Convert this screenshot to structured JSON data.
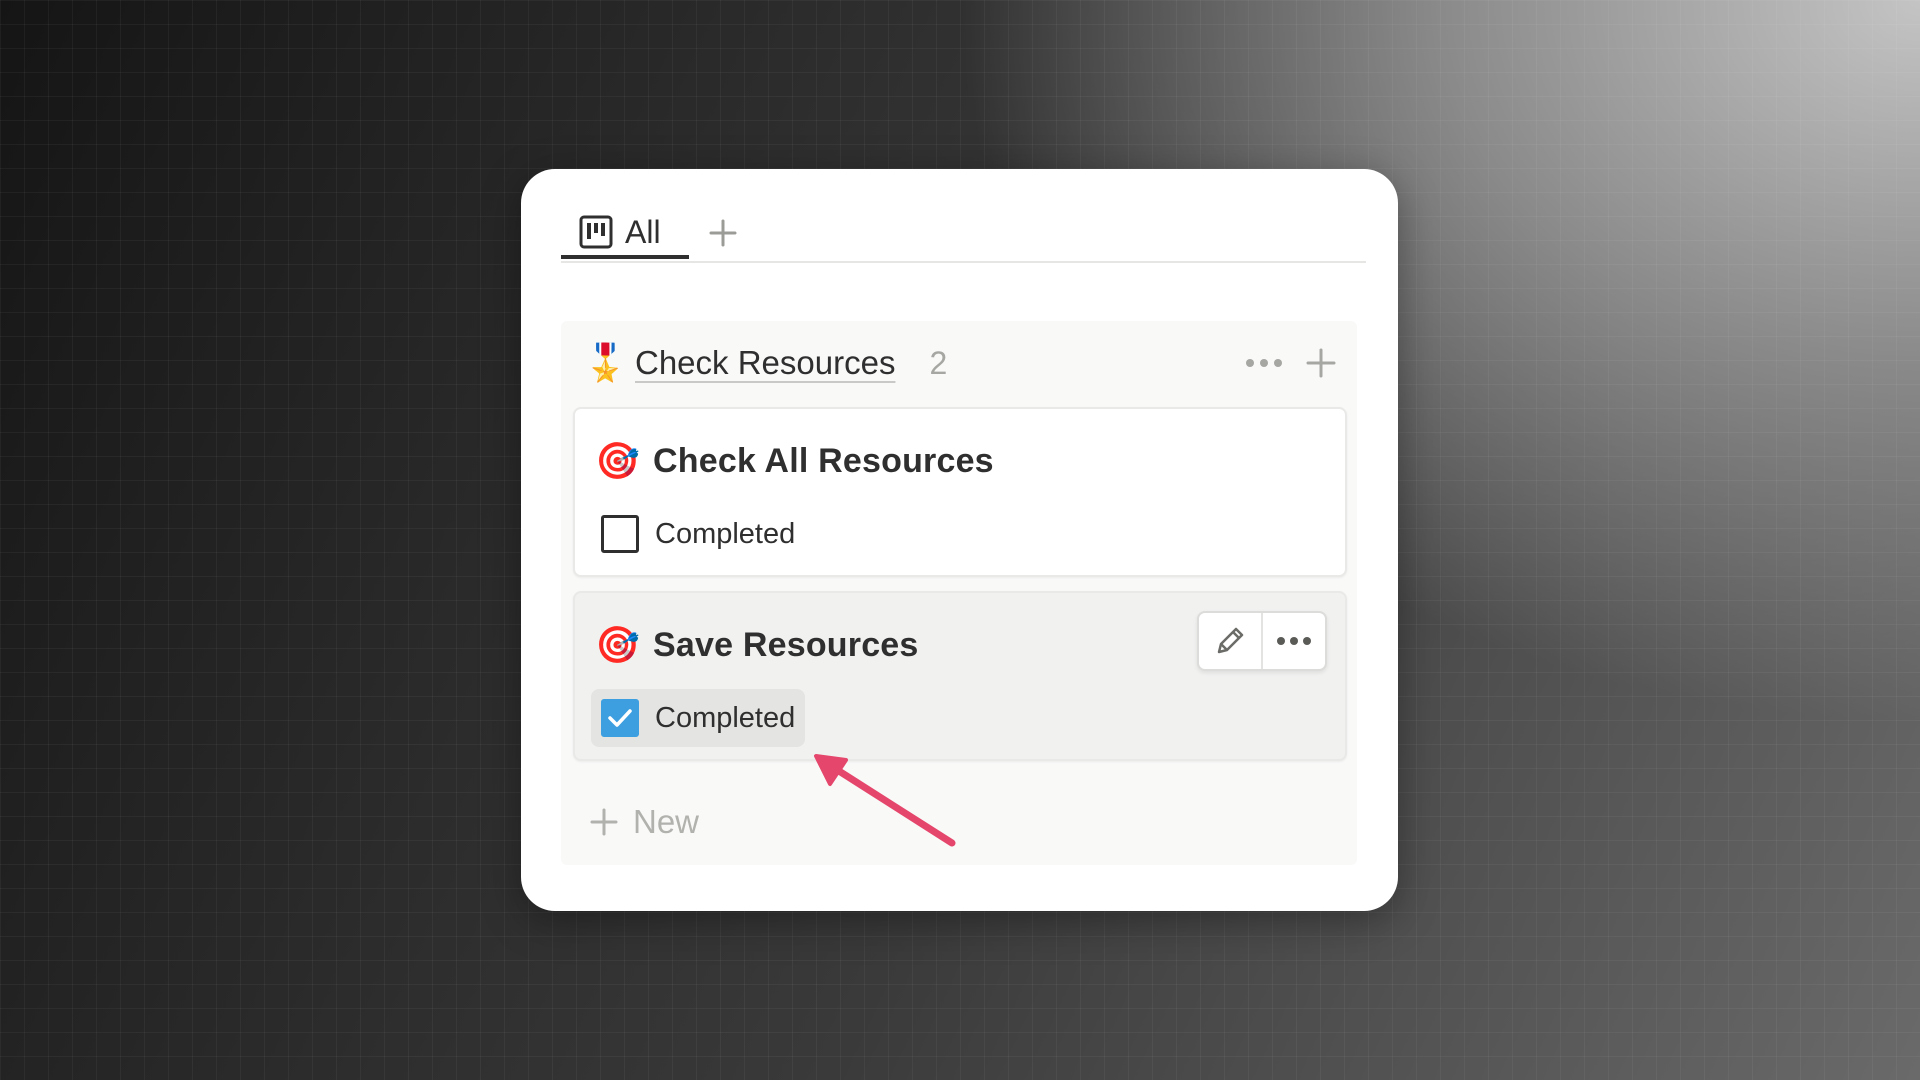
{
  "tabs": {
    "active_label": "All",
    "icon": "board-icon",
    "add_icon": "plus-icon"
  },
  "column": {
    "emoji": "🎖️",
    "title": "Check Resources",
    "count": "2",
    "actions": [
      "more-icon",
      "plus-icon"
    ]
  },
  "cards": [
    {
      "emoji": "🎯",
      "title": "Check All Resources",
      "property_label": "Completed",
      "checked": false
    },
    {
      "emoji": "🎯",
      "title": "Save Resources",
      "property_label": "Completed",
      "checked": true,
      "hover_actions": [
        "pencil-icon",
        "more-icon"
      ]
    }
  ],
  "new_item": {
    "label": "New",
    "icon": "plus-icon"
  },
  "colors": {
    "checkbox_checked": "#3d9fe0",
    "annotation_arrow": "#e5466b",
    "text_primary": "#2f2f2f",
    "text_muted": "#a6a6a3"
  }
}
